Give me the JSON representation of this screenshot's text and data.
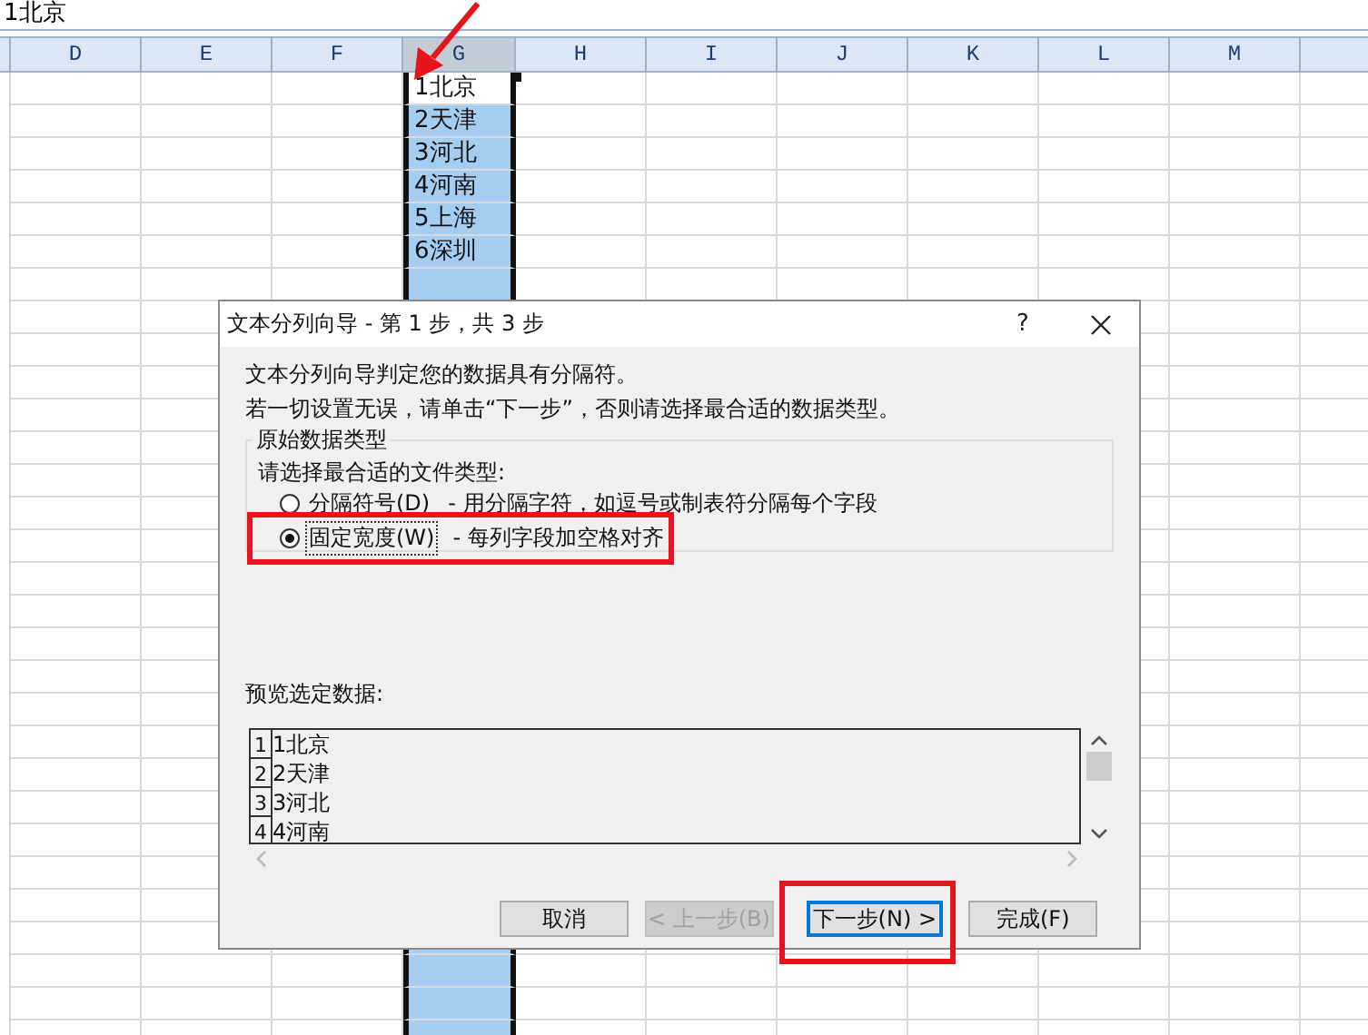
{
  "formula_bar": {
    "value": "1北京"
  },
  "sheet": {
    "columns": [
      {
        "label": "D",
        "selected": false
      },
      {
        "label": "E",
        "selected": false
      },
      {
        "label": "F",
        "selected": false
      },
      {
        "label": "G",
        "selected": true
      },
      {
        "label": "H",
        "selected": false
      },
      {
        "label": "I",
        "selected": false
      },
      {
        "label": "J",
        "selected": false
      },
      {
        "label": "K",
        "selected": false
      },
      {
        "label": "L",
        "selected": false
      },
      {
        "label": "M",
        "selected": false
      }
    ],
    "selected_cells": [
      {
        "text": "1北京",
        "active": true
      },
      {
        "text": "2天津",
        "active": false
      },
      {
        "text": "3河北",
        "active": false
      },
      {
        "text": "4河南",
        "active": false
      },
      {
        "text": "5上海",
        "active": false
      },
      {
        "text": "6深圳",
        "active": false
      }
    ]
  },
  "dialog": {
    "title": "文本分列向导 - 第 1 步，共 3 步",
    "help": "?",
    "intro": [
      "文本分列向导判定您的数据具有分隔符。",
      "若一切设置无误，请单击“下一步”，否则请选择最合适的数据类型。"
    ],
    "group": {
      "title": "原始数据类型",
      "prompt": "请选择最合适的文件类型:",
      "options": [
        {
          "label": "分隔符号(D)",
          "description": "- 用分隔字符，如逗号或制表符分隔每个字段",
          "selected": false
        },
        {
          "label": "固定宽度(W)",
          "description": "- 每列字段加空格对齐",
          "selected": true
        }
      ]
    },
    "preview": {
      "label": "预览选定数据:",
      "rows": [
        {
          "number": "1",
          "text": "1北京"
        },
        {
          "number": "2",
          "text": "2天津"
        },
        {
          "number": "3",
          "text": "3河北"
        },
        {
          "number": "4",
          "text": "4河南"
        }
      ]
    },
    "buttons": [
      {
        "label": "取消",
        "disabled": false,
        "default": false
      },
      {
        "label": "< 上一步(B)",
        "disabled": true,
        "default": false
      },
      {
        "label": "下一步(N) >",
        "disabled": false,
        "default": true
      },
      {
        "label": "完成(F)",
        "disabled": false,
        "default": false
      }
    ]
  },
  "annotations": [
    {
      "kind": "arrow"
    },
    {
      "kind": "optionbox"
    },
    {
      "kind": "buttonbox"
    }
  ]
}
